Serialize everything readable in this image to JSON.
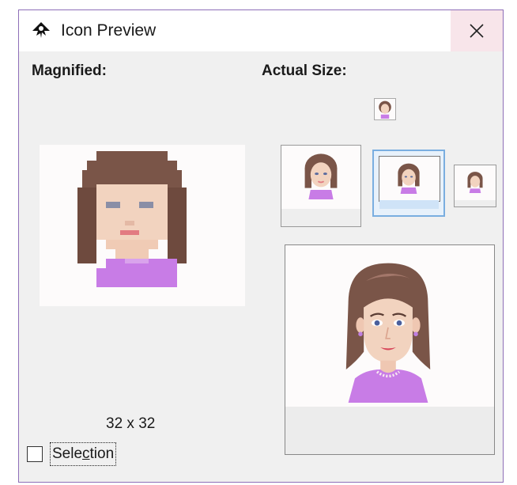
{
  "window": {
    "title": "Icon Preview",
    "app_icon": "inkscape-logo-icon",
    "close_icon": "close-icon"
  },
  "labels": {
    "magnified": "Magnified:",
    "actual_size": "Actual Size:"
  },
  "magnified_size": "32 x 32",
  "selection": {
    "label_before": "Sele",
    "label_mnemonic": "c",
    "label_after": "tion",
    "checked": false
  },
  "icon_sizes": [
    "16",
    "48",
    "32",
    "24",
    "128"
  ],
  "selected_size": "32",
  "colors": {
    "hair": "#7a5548",
    "skin": "#f2d3bf",
    "shirt": "#c87ce6",
    "selection_border": "#7aaee0",
    "window_border": "#8e6fb8"
  }
}
